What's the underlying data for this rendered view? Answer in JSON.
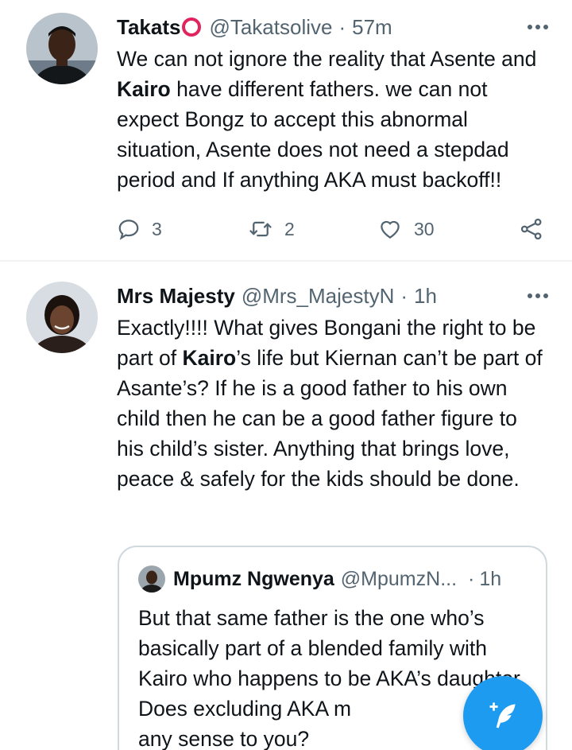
{
  "tweets": [
    {
      "display_name": "Takats",
      "handle": "@Takatsolive",
      "separator": "·",
      "time": "57m",
      "avatar": "profile-photo",
      "body": {
        "before": "We can not ignore the reality that Asente and ",
        "bold": "Kairo",
        "after": " have different fathers. we can not expect Bongz to accept this abnormal situation, Asente does not need a stepdad period and If anything AKA must backoff!!"
      },
      "actions": {
        "reply_count": "3",
        "retweet_count": "2",
        "like_count": "30"
      }
    },
    {
      "display_name": "Mrs Majesty",
      "handle": "@Mrs_MajestyN",
      "separator": "·",
      "time": "1h",
      "avatar": "profile-photo",
      "body": {
        "before": "Exactly!!!! What gives Bongani the right to be part of ",
        "bold": "Kairo",
        "after": "’s life but Kiernan can’t be part of Asante’s? If he is a good father to his own child then he can be a good father figure to his child’s sister. Anything that brings love, peace & safely for the kids should be done."
      },
      "quote": {
        "display_name": "Mpumz Ngwenya",
        "handle": "@MpumzN...",
        "separator": "·",
        "time": "1h",
        "text": "But that same father is the one who’s basically part of a blended family with Kairo who happens to be AKA’s daughter. Does excluding AKA m\nany sense to you?"
      }
    }
  ],
  "icons": {
    "more": "more-horizontal-icon",
    "reply": "reply-icon",
    "retweet": "retweet-icon",
    "like": "heart-icon",
    "share": "share-icon",
    "compose": "compose-tweet-icon"
  },
  "colors": {
    "text": "#0f1419",
    "secondary": "#536471",
    "accent": "#1d9bf0",
    "badge": "#e0245e",
    "border": "#cfd9de"
  }
}
